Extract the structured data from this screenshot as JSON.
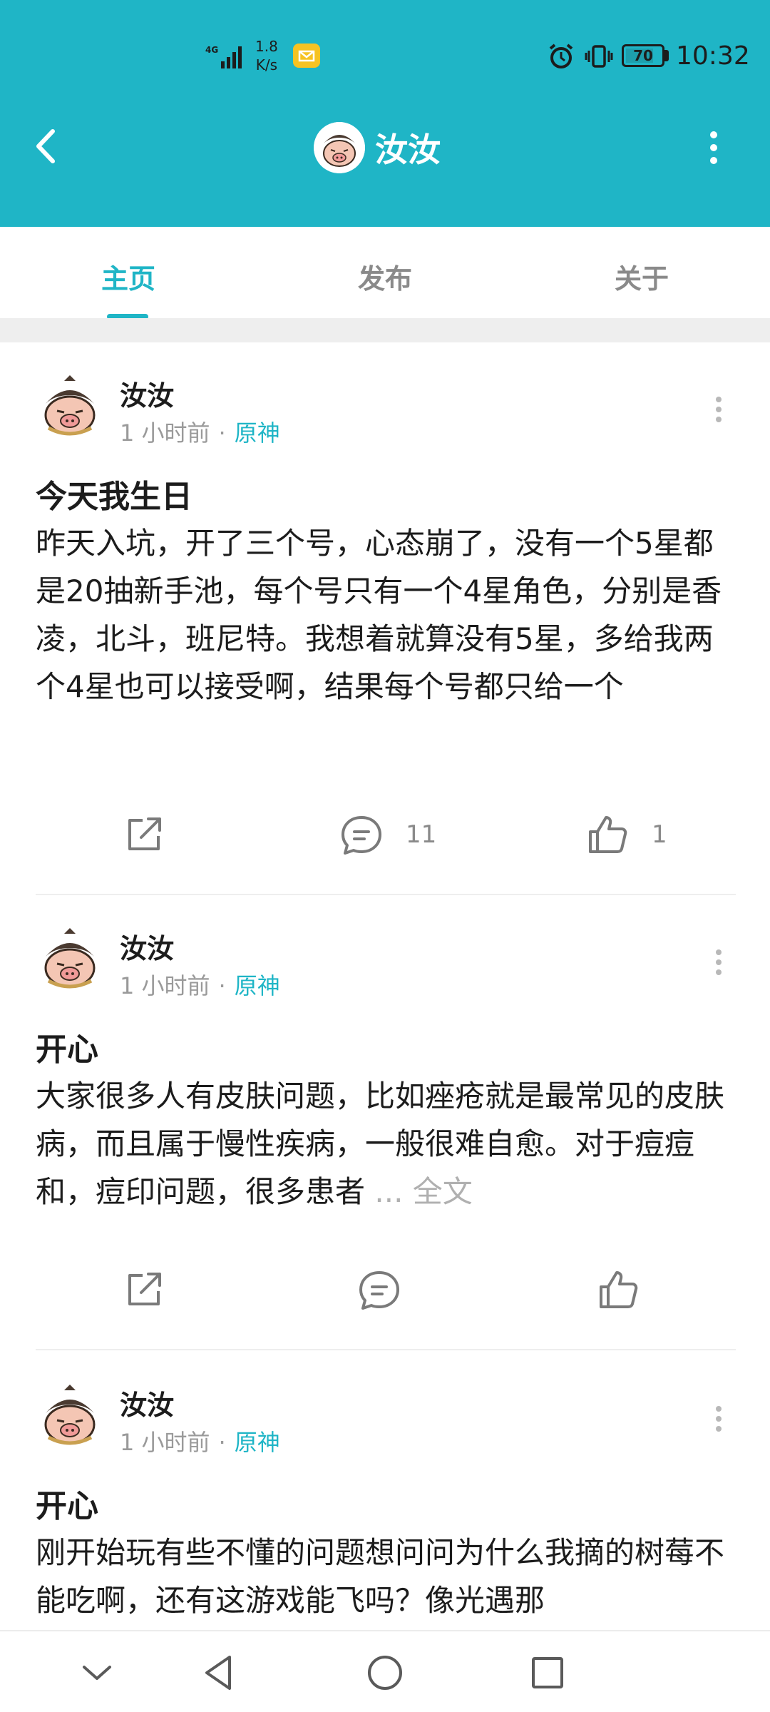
{
  "status_bar": {
    "network": "4G",
    "speed_value": "1.8",
    "speed_unit": "K/s",
    "battery": "70",
    "time": "10:32"
  },
  "header": {
    "title": "汝汝"
  },
  "tabs": [
    {
      "label": "主页",
      "active": true
    },
    {
      "label": "发布",
      "active": false
    },
    {
      "label": "关于",
      "active": false
    }
  ],
  "posts": [
    {
      "author": "汝汝",
      "time": "1 小时前",
      "separator": "·",
      "tag": "原神",
      "title": "今天我生日",
      "body": "昨天入坑，开了三个号，心态崩了，没有一个5星都是20抽新手池，每个号只有一个4星角色，分别是香凌，北斗，班尼特。我想着就算没有5星，多给我两个4星也可以接受啊，结果每个号都只给一个",
      "more": "",
      "comments": "11",
      "likes": "1"
    },
    {
      "author": "汝汝",
      "time": "1 小时前",
      "separator": "·",
      "tag": "原神",
      "title": "开心",
      "body": "大家很多人有皮肤问题，比如痤疮就是最常见的皮肤病，而且属于慢性疾病，一般很难自愈。对于痘痘和，痘印问题，很多患者",
      "more": " ... 全文",
      "comments": "",
      "likes": ""
    },
    {
      "author": "汝汝",
      "time": "1 小时前",
      "separator": "·",
      "tag": "原神",
      "title": "开心",
      "body": "刚开始玩有些不懂的问题想问问为什么我摘的树莓不能吃啊，还有这游戏能飞吗？像光遇那",
      "more": "",
      "comments": "",
      "likes": ""
    }
  ],
  "colors": {
    "accent": "#1fb5c6",
    "text": "#1c1c1c",
    "muted": "#9a9a9a"
  },
  "icons": {
    "back": "chevron-left-icon",
    "more": "more-vertical-icon",
    "share": "share-icon",
    "comment": "comment-icon",
    "like": "thumbs-up-icon"
  }
}
